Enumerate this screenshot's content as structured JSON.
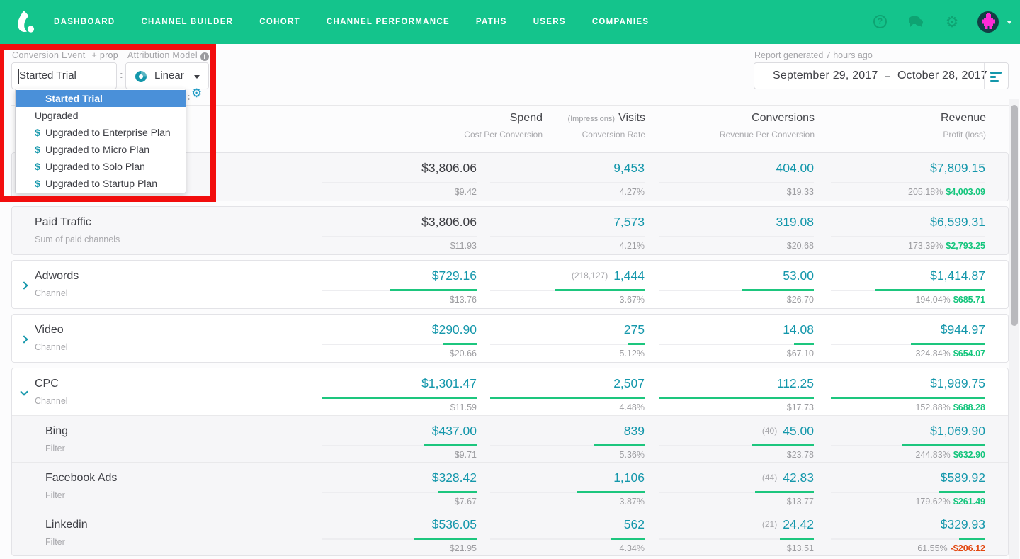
{
  "nav": {
    "items": [
      "DASHBOARD",
      "CHANNEL BUILDER",
      "COHORT",
      "CHANNEL PERFORMANCE",
      "PATHS",
      "USERS",
      "COMPANIES"
    ]
  },
  "controls": {
    "conversion_event_label": "Conversion Event",
    "prop_label": "+ prop",
    "conversion_event_value": "Started Trial",
    "separator": ":",
    "attribution_model_label": "Attribution Model",
    "attribution_model_value": "Linear",
    "report_note": "Report generated 7 hours ago",
    "date_start": "September 29, 2017",
    "date_separator": "–",
    "date_end": "October 28, 2017"
  },
  "dropdown": {
    "dollar_symbol": "$",
    "items": [
      {
        "label": "Started Trial",
        "selected": true,
        "dollar": false
      },
      {
        "label": "Upgraded",
        "selected": false,
        "dollar": false
      },
      {
        "label": "Upgraded to Enterprise Plan",
        "selected": false,
        "dollar": true
      },
      {
        "label": "Upgraded to Micro Plan",
        "selected": false,
        "dollar": true
      },
      {
        "label": "Upgraded to Solo Plan",
        "selected": false,
        "dollar": true
      },
      {
        "label": "Upgraded to Startup Plan",
        "selected": false,
        "dollar": true
      }
    ]
  },
  "table": {
    "columns": [
      {
        "pre": "",
        "title": "Spend",
        "sub": "Cost Per Conversion"
      },
      {
        "pre": "(Impressions)",
        "title": "Visits",
        "sub": "Conversion Rate"
      },
      {
        "pre": "",
        "title": "Conversions",
        "sub": "Revenue Per Conversion"
      },
      {
        "pre": "",
        "title": "Revenue",
        "sub": "Profit (loss)"
      }
    ],
    "rows": [
      {
        "name": "",
        "sub": "",
        "cells": [
          {
            "paren": "",
            "main": "$3,806.06",
            "sub": "$9.42",
            "bar": 0
          },
          {
            "paren": "",
            "main": "9,453",
            "sub": "4.27%",
            "bar": 0
          },
          {
            "paren": "",
            "main": "404.00",
            "sub": "$19.33",
            "bar": 0
          },
          {
            "main": "$7,809.15",
            "bar": 0,
            "pct": "205.18%",
            "profit": "$4,003.09"
          }
        ]
      },
      {
        "name": "Paid Traffic",
        "sub": "Sum of paid channels",
        "cells": [
          {
            "paren": "",
            "main": "$3,806.06",
            "sub": "$11.93",
            "bar": 0
          },
          {
            "paren": "",
            "main": "7,573",
            "sub": "4.21%",
            "bar": 0
          },
          {
            "paren": "",
            "main": "319.08",
            "sub": "$20.68",
            "bar": 0
          },
          {
            "main": "$6,599.31",
            "bar": 0,
            "pct": "173.39%",
            "profit": "$2,793.25"
          }
        ]
      },
      {
        "name": "Adwords",
        "sub": "Channel",
        "cells": [
          {
            "paren": "",
            "main": "$729.16",
            "sub": "$13.76",
            "bar": 0.56
          },
          {
            "paren": "(218,127)",
            "main": "1,444",
            "sub": "3.67%",
            "bar": 0.58
          },
          {
            "paren": "",
            "main": "53.00",
            "sub": "$26.70",
            "bar": 0.47
          },
          {
            "main": "$1,414.87",
            "bar": 0.71,
            "pct": "194.04%",
            "profit": "$685.71"
          }
        ]
      },
      {
        "name": "Video",
        "sub": "Channel",
        "cells": [
          {
            "paren": "",
            "main": "$290.90",
            "sub": "$20.66",
            "bar": 0.22
          },
          {
            "paren": "",
            "main": "275",
            "sub": "5.12%",
            "bar": 0.11
          },
          {
            "paren": "",
            "main": "14.08",
            "sub": "$67.10",
            "bar": 0.13
          },
          {
            "main": "$944.97",
            "bar": 0.48,
            "pct": "324.84%",
            "profit": "$654.07"
          }
        ]
      },
      {
        "name": "CPC",
        "sub": "Channel",
        "cells": [
          {
            "paren": "",
            "main": "$1,301.47",
            "sub": "$11.59",
            "bar": 1
          },
          {
            "paren": "",
            "main": "2,507",
            "sub": "4.48%",
            "bar": 1
          },
          {
            "paren": "",
            "main": "112.25",
            "sub": "$17.73",
            "bar": 1
          },
          {
            "main": "$1,989.75",
            "bar": 1,
            "pct": "152.88%",
            "profit": "$688.28"
          }
        ]
      },
      {
        "name": "Bing",
        "sub": "Filter",
        "cells": [
          {
            "paren": "",
            "main": "$437.00",
            "sub": "$9.71",
            "bar": 0.34
          },
          {
            "paren": "",
            "main": "839",
            "sub": "5.36%",
            "bar": 0.33
          },
          {
            "paren": "(40)",
            "main": "45.00",
            "sub": "$23.78",
            "bar": 0.4
          },
          {
            "main": "$1,069.90",
            "bar": 0.54,
            "pct": "244.83%",
            "profit": "$632.90"
          }
        ]
      },
      {
        "name": "Facebook Ads",
        "sub": "Filter",
        "cells": [
          {
            "paren": "",
            "main": "$328.42",
            "sub": "$7.67",
            "bar": 0.25
          },
          {
            "paren": "",
            "main": "1,106",
            "sub": "3.87%",
            "bar": 0.44
          },
          {
            "paren": "(44)",
            "main": "42.83",
            "sub": "$13.77",
            "bar": 0.38
          },
          {
            "main": "$589.92",
            "bar": 0.3,
            "pct": "179.62%",
            "profit": "$261.49"
          }
        ]
      },
      {
        "name": "Linkedin",
        "sub": "Filter",
        "cells": [
          {
            "paren": "",
            "main": "$536.05",
            "sub": "$21.95",
            "bar": 0.41
          },
          {
            "paren": "",
            "main": "562",
            "sub": "4.34%",
            "bar": 0.22
          },
          {
            "paren": "(21)",
            "main": "24.42",
            "sub": "$13.51",
            "bar": 0.22
          },
          {
            "main": "$329.93",
            "bar": 0.17,
            "pct": "61.55%",
            "profit": "-$206.12"
          }
        ]
      }
    ]
  },
  "colors": {
    "nav_green": "#14c48c",
    "teal": "#1497ab",
    "bar_green": "#1dc67e",
    "profit_green": "#13c57c",
    "loss_red": "#e2470f",
    "selected_blue": "#4a90d9",
    "annotation_red": "#f20d0d"
  }
}
